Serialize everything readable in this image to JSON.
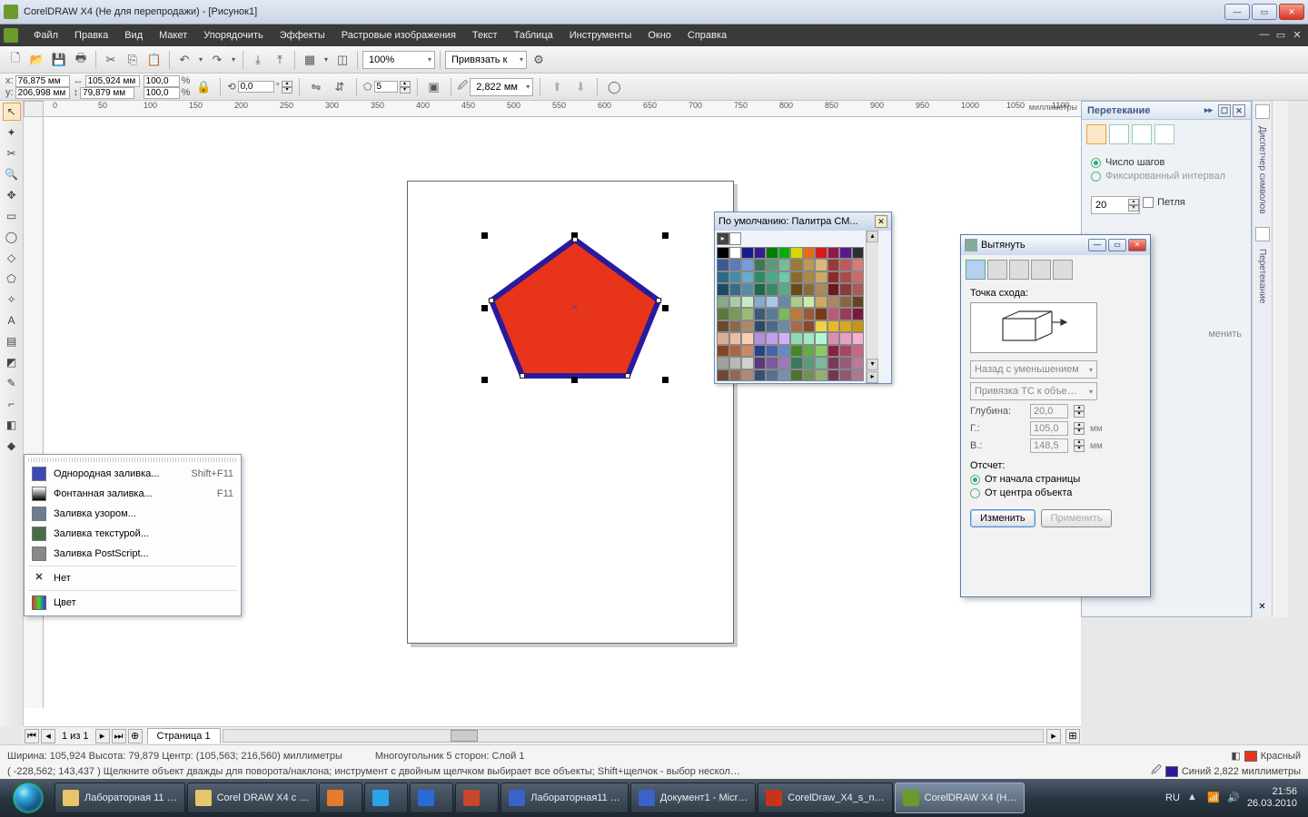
{
  "window": {
    "title": "CorelDRAW X4 (Не для перепродажи) - [Рисунок1]"
  },
  "menu": {
    "items": [
      "Файл",
      "Правка",
      "Вид",
      "Макет",
      "Упорядочить",
      "Эффекты",
      "Растровые изображения",
      "Текст",
      "Таблица",
      "Инструменты",
      "Окно",
      "Справка"
    ]
  },
  "tb1": {
    "zoom": "100%",
    "snap_label": "Привязать к"
  },
  "prop": {
    "x_label": "x:",
    "x": "76,875 мм",
    "y_label": "y:",
    "y": "206,998 мм",
    "w": "105,924 мм",
    "h": "79,879 мм",
    "sx": "100,0",
    "sy": "100,0",
    "pct": "%",
    "rot": "0,0",
    "deg": "°",
    "sides": "5",
    "outline": "2,822 мм"
  },
  "ruler_unit": "миллиметры",
  "toolbox_icons": [
    "↖",
    "✦",
    "✂",
    "🔍",
    "✥",
    "▭",
    "◯",
    "◇",
    "⬠",
    "✧",
    "A",
    "▤",
    "◩",
    "✎",
    "⌐",
    "◧",
    "◆"
  ],
  "fill_menu": {
    "items": [
      {
        "label": "Однородная заливка...",
        "shortcut": "Shift+F11",
        "icon": "#3b49b8"
      },
      {
        "label": "Фонтанная заливка...",
        "shortcut": "F11",
        "icon": "grad"
      },
      {
        "label": "Заливка узором...",
        "shortcut": "",
        "icon": "#6a7d93"
      },
      {
        "label": "Заливка текстурой...",
        "shortcut": "",
        "icon": "#4a6b4a"
      },
      {
        "label": "Заливка PostScript...",
        "shortcut": "",
        "icon": "#888"
      }
    ],
    "none": "Нет",
    "color": "Цвет"
  },
  "palette": {
    "title": "По умолчанию: Палитра СМ..."
  },
  "blend": {
    "title": "Перетекание",
    "steps_label": "Число шагов",
    "fixed_label": "Фиксированный интервал",
    "steps": "20",
    "loop": "Петля",
    "apply": "менить"
  },
  "extrude": {
    "title": "Вытянуть",
    "vanish": "Точка схода:",
    "type": "Назад с уменьшением",
    "snap": "Привязка ТС к объе…",
    "depth_l": "Глубина:",
    "depth": "20,0",
    "h_l": "Г.:",
    "h": "105,0",
    "unit": "мм",
    "v_l": "В.:",
    "v": "148,5",
    "ref": "Отсчет:",
    "ref1": "От начала страницы",
    "ref2": "От центра объекта",
    "edit": "Изменить",
    "apply": "Применить"
  },
  "pagenav": {
    "of": "1 из 1",
    "tab": "Страница 1"
  },
  "status": {
    "line1_a": "Ширина: 105,924  Высота: 79,879  Центр: (105,563; 216,560)  миллиметры",
    "line1_b": "Многоугольник  5 сторон: Слой 1",
    "line2": "( -228,562; 143,437 )     Щелкните объект дважды для поворота/наклона; инструмент с двойным щелчком выбирает все объекты; Shift+щелчок - выбор нескол…",
    "fill_name": "Красный",
    "outline_name": "Синий  2,822 миллиметры",
    "fill_color": "#e8341a",
    "outline_color": "#2a1a9d"
  },
  "taskbar": {
    "items": [
      {
        "label": "Лабораторная 11 …",
        "icon": "#e8c56a"
      },
      {
        "label": "Corel DRAW X4 с …",
        "icon": "#e8c56a"
      },
      {
        "label": "",
        "icon": "#e87a2a"
      },
      {
        "label": "",
        "icon": "#2aa4e8"
      },
      {
        "label": "",
        "icon": "#2a6ad8"
      },
      {
        "label": "",
        "icon": "#c8472b"
      },
      {
        "label": "Лабораторная11 …",
        "icon": "#3a62c8"
      },
      {
        "label": "Документ1 - Micr…",
        "icon": "#3a62c8"
      },
      {
        "label": "CorelDraw_X4_s_n…",
        "icon": "#c8341a"
      },
      {
        "label": "CorelDRAW X4 (Н…",
        "icon": "#6a9a2d",
        "active": true
      }
    ],
    "lang": "RU",
    "time": "21:56",
    "date": "26.03.2010"
  },
  "minidock": {
    "label1": "Диспетчер символов",
    "label2": "Перетекание"
  },
  "palette_colors": [
    "#000000",
    "#ffffff",
    "#1a1a8f",
    "#3b1a8f",
    "#008000",
    "#00b000",
    "#d8d800",
    "#e86b1a",
    "#d81a1a",
    "#8f1a4a",
    "#5a1a8f",
    "#303030",
    "#3a5a9a",
    "#5a7aba",
    "#7a9ada",
    "#3a7a5a",
    "#5a9a7a",
    "#7aba9a",
    "#9a7a3a",
    "#ba9a5a",
    "#daba7a",
    "#9a3a3a",
    "#ba5a5a",
    "#da7a7a",
    "#2a6a8a",
    "#4a8aaa",
    "#6aaaca",
    "#2a8a6a",
    "#4aaa8a",
    "#6acaaa",
    "#8a6a2a",
    "#aa8a4a",
    "#caaa6a",
    "#8a2a2a",
    "#aa4a4a",
    "#ca6a6a",
    "#1a4a6a",
    "#3a6a8a",
    "#5a8aaa",
    "#1a6a4a",
    "#3a8a6a",
    "#5aaa8a",
    "#6a4a1a",
    "#8a6a3a",
    "#aa8a5a",
    "#6a1a1a",
    "#8a3a3a",
    "#aa5a5a",
    "#88aa88",
    "#a8caa8",
    "#c8eac8",
    "#88aacc",
    "#a8caec",
    "#6688aa",
    "#aacc88",
    "#caeca8",
    "#ccaa66",
    "#aa8866",
    "#886644",
    "#664422",
    "#5a7a3a",
    "#7a9a5a",
    "#9aba7a",
    "#3a5a7a",
    "#5a7a9a",
    "#7aba5a",
    "#ba7a3a",
    "#9a5a3a",
    "#7a3a1a",
    "#ba5a7a",
    "#9a3a5a",
    "#7a1a3a",
    "#6a4a2a",
    "#8a6a4a",
    "#aa8a6a",
    "#2a4a6a",
    "#4a6a8a",
    "#6a8aaa",
    "#aa6a4a",
    "#8a4a2a",
    "#ecd24a",
    "#e8b82a",
    "#d8a81a",
    "#c8980a",
    "#d8b090",
    "#e8c0a0",
    "#f8d0b0",
    "#b090d8",
    "#c0a0e8",
    "#d0b0f8",
    "#90d8b0",
    "#a0e8c0",
    "#b0f8d0",
    "#d890b0",
    "#e8a0c0",
    "#f8b0d0",
    "#884422",
    "#aa6644",
    "#cc8866",
    "#224488",
    "#4466aa",
    "#6688cc",
    "#448822",
    "#66aa44",
    "#88cc66",
    "#882244",
    "#aa4466",
    "#cc6688",
    "#a0a0a0",
    "#b8b8b8",
    "#d0d0d0",
    "#5a3a7a",
    "#7a5a9a",
    "#9a7aba",
    "#3a7a5a",
    "#5a9a7a",
    "#7aba9a",
    "#7a3a5a",
    "#9a5a7a",
    "#ba7a9a",
    "#704838",
    "#906858",
    "#b08878",
    "#385070",
    "#587090",
    "#7890b0",
    "#507038",
    "#709058",
    "#90b078",
    "#703850",
    "#905870",
    "#b07890"
  ]
}
